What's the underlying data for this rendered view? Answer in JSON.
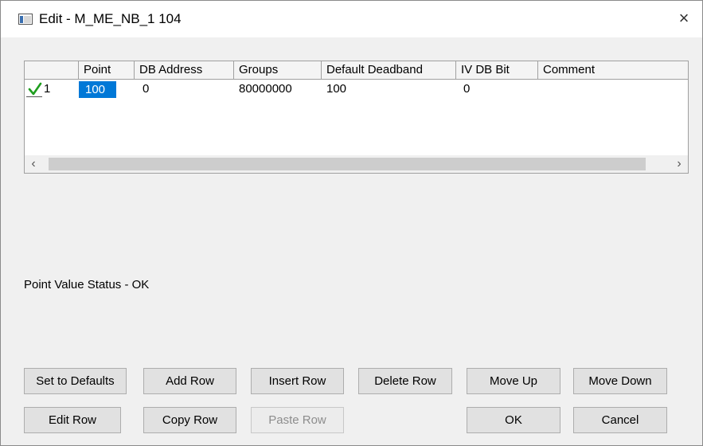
{
  "window": {
    "title": "Edit - M_ME_NB_1 104",
    "close_glyph": "×"
  },
  "grid": {
    "columns": [
      "",
      "Point",
      "DB Address",
      "Groups",
      "Default Deadband",
      "IV DB Bit",
      "Comment"
    ],
    "rows": [
      {
        "row_number": "1",
        "status_icon": "check-icon",
        "point": "100",
        "db_address": "0",
        "groups": "80000000",
        "default_deadband": "100",
        "iv_db_bit": "0",
        "comment": ""
      }
    ]
  },
  "status_text": "Point Value Status - OK",
  "buttons": {
    "set_to_defaults": "Set to Defaults",
    "add_row": "Add Row",
    "insert_row": "Insert Row",
    "delete_row": "Delete Row",
    "move_up": "Move Up",
    "move_down": "Move Down",
    "edit_row": "Edit Row",
    "copy_row": "Copy Row",
    "paste_row": "Paste Row",
    "ok": "OK",
    "cancel": "Cancel"
  },
  "colors": {
    "selection": "#0078d7",
    "check": "#1e9e1e"
  }
}
